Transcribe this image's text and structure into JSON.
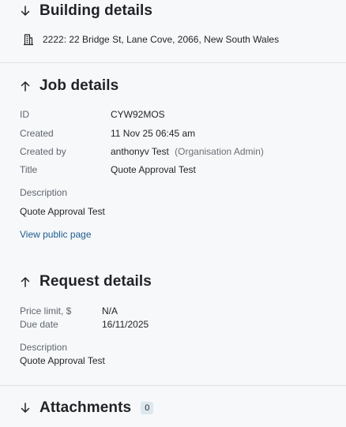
{
  "building": {
    "title": "Building details",
    "address": "2222: 22 Bridge St, Lane Cove, 2066, New South Wales"
  },
  "job": {
    "title": "Job details",
    "id_label": "ID",
    "id_value": "CYW92MOS",
    "created_label": "Created",
    "created_value": "11 Nov 25 06:45 am",
    "created_by_label": "Created by",
    "created_by_name": "anthonyv Test",
    "created_by_role": "(Organisation Admin)",
    "title_label": "Title",
    "title_value": "Quote Approval Test",
    "description_label": "Description",
    "description_value": "Quote Approval Test",
    "public_link": "View public page"
  },
  "request": {
    "title": "Request details",
    "price_label": "Price limit, $",
    "price_value": "N/A",
    "due_label": "Due date",
    "due_value": "16/11/2025",
    "description_label": "Description",
    "description_value": "Quote Approval Test"
  },
  "attachments": {
    "title": "Attachments",
    "count": "0"
  },
  "colors": {
    "link": "#1d5c8f",
    "badge_bg": "#dde7ee",
    "label": "#5f6670"
  }
}
